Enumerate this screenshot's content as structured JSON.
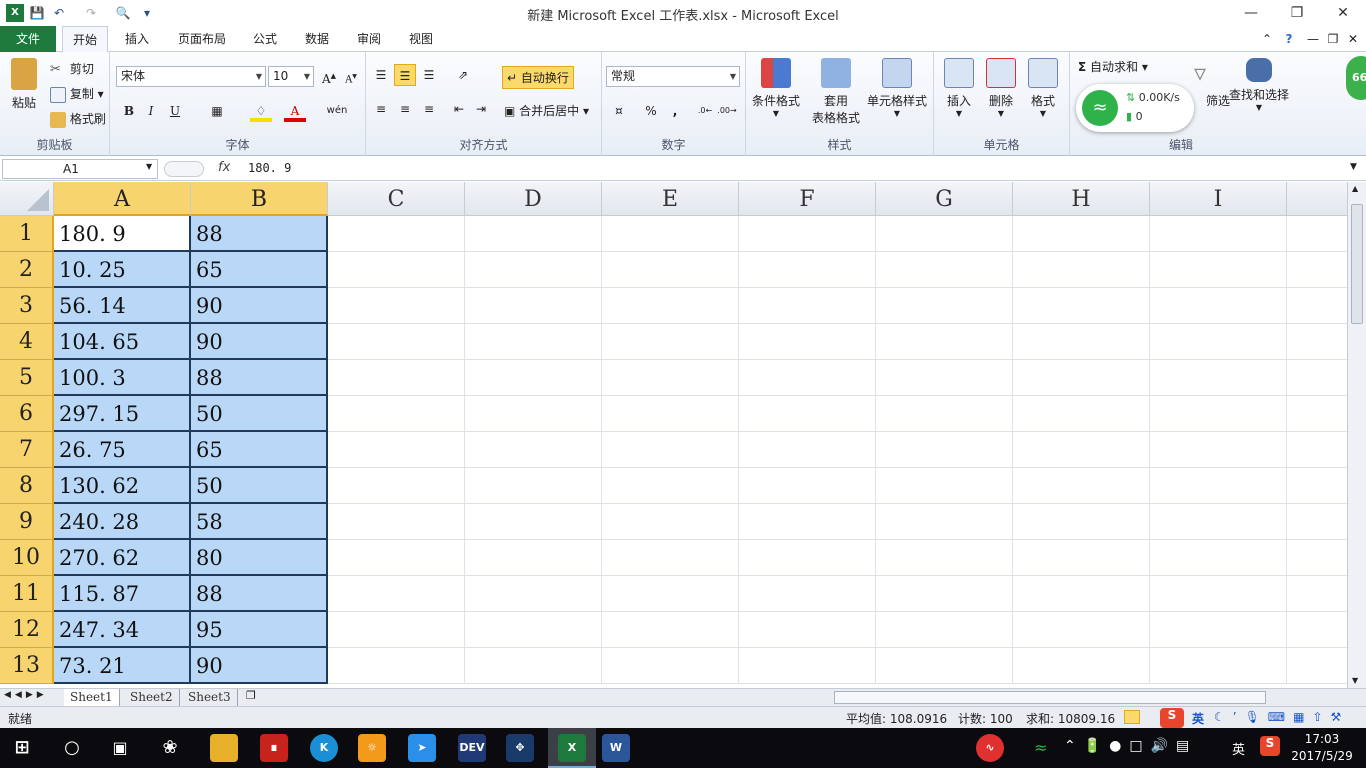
{
  "window": {
    "title": "新建 Microsoft Excel 工作表.xlsx - Microsoft Excel"
  },
  "tabs": [
    {
      "label": "文件"
    },
    {
      "label": "开始"
    },
    {
      "label": "插入"
    },
    {
      "label": "页面布局"
    },
    {
      "label": "公式"
    },
    {
      "label": "数据"
    },
    {
      "label": "审阅"
    },
    {
      "label": "视图"
    }
  ],
  "ribbon": {
    "clipboard": {
      "label": "剪贴板",
      "paste": "粘贴",
      "cut": "剪切",
      "copy": "复制",
      "format_painter": "格式刷"
    },
    "font": {
      "label": "字体",
      "name": "宋体",
      "size": "10",
      "bold": "B",
      "italic": "I",
      "underline": "U"
    },
    "alignment": {
      "label": "对齐方式",
      "wrap": "自动换行",
      "merge": "合并后居中"
    },
    "number": {
      "label": "数字",
      "format": "常规",
      "percent": "%",
      "comma": ","
    },
    "styles": {
      "label": "样式",
      "conditional": "条件格式",
      "table_format_1": "套用",
      "table_format_2": "表格格式",
      "cell_styles": "单元格样式"
    },
    "cells": {
      "label": "单元格",
      "insert": "插入",
      "delete": "删除",
      "format": "格式"
    },
    "editing": {
      "label": "编辑",
      "autosum": "自动求和",
      "sort_filter": "筛选",
      "find_select": "查找和选择"
    }
  },
  "formula_bar": {
    "name_box": "A1",
    "fx": "fx",
    "value": "180. 9"
  },
  "columns": [
    "A",
    "B",
    "C",
    "D",
    "E",
    "F",
    "G",
    "H",
    "I"
  ],
  "rows": [
    {
      "n": "1",
      "a": "180. 9",
      "b": "88"
    },
    {
      "n": "2",
      "a": "10. 25",
      "b": "65"
    },
    {
      "n": "3",
      "a": "56. 14",
      "b": "90"
    },
    {
      "n": "4",
      "a": "104. 65",
      "b": "90"
    },
    {
      "n": "5",
      "a": "100. 3",
      "b": "88"
    },
    {
      "n": "6",
      "a": "297. 15",
      "b": "50"
    },
    {
      "n": "7",
      "a": "26. 75",
      "b": "65"
    },
    {
      "n": "8",
      "a": "130. 62",
      "b": "50"
    },
    {
      "n": "9",
      "a": "240. 28",
      "b": "58"
    },
    {
      "n": "10",
      "a": "270. 62",
      "b": "80"
    },
    {
      "n": "11",
      "a": "115. 87",
      "b": "88"
    },
    {
      "n": "12",
      "a": "247. 34",
      "b": "95"
    },
    {
      "n": "13",
      "a": "73. 21",
      "b": "90"
    }
  ],
  "sheets": [
    {
      "label": "Sheet1"
    },
    {
      "label": "Sheet2"
    },
    {
      "label": "Sheet3"
    }
  ],
  "status": {
    "ready": "就绪",
    "average": "平均值: 108.0916",
    "count": "计数: 100",
    "sum": "求和: 10809.16"
  },
  "network_widget": {
    "speed": "0.00K/s",
    "count": "0"
  },
  "ribbon_badge": "66",
  "taskbar": {
    "time": "17:03",
    "date": "2017/5/29",
    "ime": "英",
    "ime_tray": "英",
    "dev_label": "DEV"
  },
  "colors": {
    "excel_green": "#1e7a3c",
    "selection_blue": "#b9d8f7",
    "header_selected": "#f8d46e"
  }
}
